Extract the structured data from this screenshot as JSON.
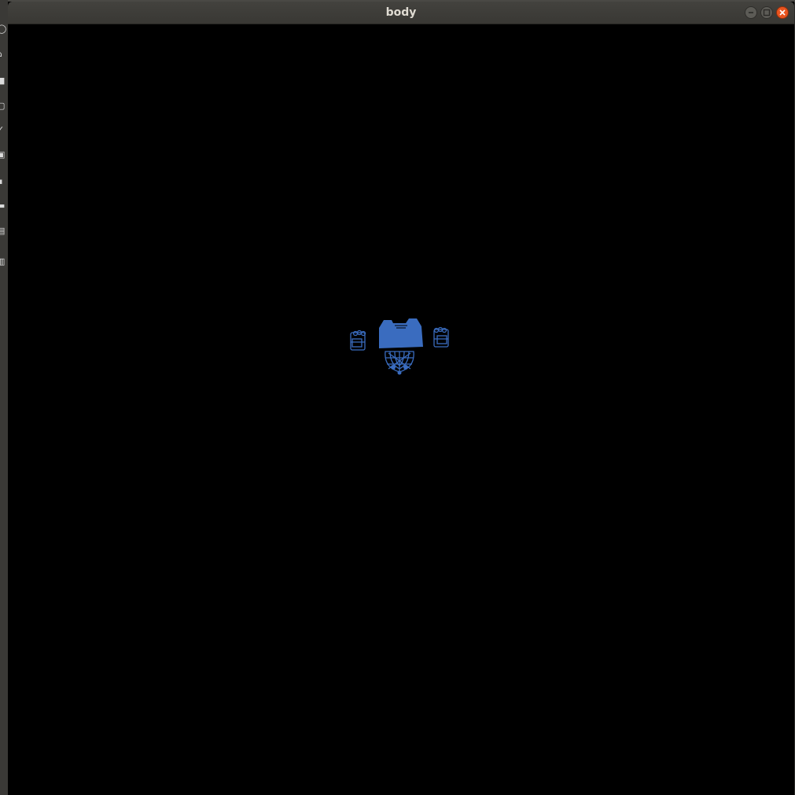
{
  "window": {
    "title": "body",
    "controls": {
      "minimize": "minimize",
      "maximize": "maximize",
      "close": "close"
    }
  },
  "viewport": {
    "background": "#000000",
    "model_color": "#3a6cbf",
    "model_name": "body-model"
  },
  "colors": {
    "titlebar": "#3e3d39",
    "title_text": "#dfdbd2",
    "close_button": "#e9541f",
    "window_button": "#5c5b56"
  }
}
